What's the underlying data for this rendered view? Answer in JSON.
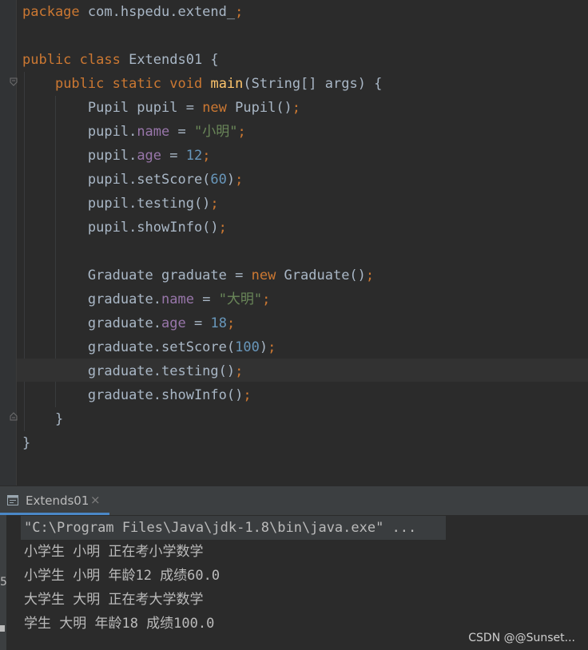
{
  "editor": {
    "lines": [
      {
        "indent": "",
        "tokens": [
          {
            "t": "package ",
            "c": "kw"
          },
          {
            "t": "com.hspedu.extend_",
            "c": "pl"
          },
          {
            "t": ";",
            "c": "kw"
          }
        ]
      },
      {
        "indent": "",
        "tokens": []
      },
      {
        "indent": "",
        "tokens": [
          {
            "t": "public ",
            "c": "kw"
          },
          {
            "t": "class ",
            "c": "kw"
          },
          {
            "t": "Extends01 {",
            "c": "pl"
          }
        ]
      },
      {
        "indent": "    ",
        "tokens": [
          {
            "t": "public ",
            "c": "kw"
          },
          {
            "t": "static ",
            "c": "kw"
          },
          {
            "t": "void ",
            "c": "kw"
          },
          {
            "t": "main",
            "c": "fn"
          },
          {
            "t": "(String[] args) {",
            "c": "pl"
          }
        ]
      },
      {
        "indent": "        ",
        "tokens": [
          {
            "t": "Pupil pupil = ",
            "c": "pl"
          },
          {
            "t": "new ",
            "c": "kw"
          },
          {
            "t": "Pupil()",
            "c": "pl"
          },
          {
            "t": ";",
            "c": "kw"
          }
        ]
      },
      {
        "indent": "        ",
        "tokens": [
          {
            "t": "pupil.",
            "c": "pl"
          },
          {
            "t": "name",
            "c": "fld"
          },
          {
            "t": " = ",
            "c": "pl"
          },
          {
            "t": "\"小明\"",
            "c": "str"
          },
          {
            "t": ";",
            "c": "kw"
          }
        ]
      },
      {
        "indent": "        ",
        "tokens": [
          {
            "t": "pupil.",
            "c": "pl"
          },
          {
            "t": "age",
            "c": "fld"
          },
          {
            "t": " = ",
            "c": "pl"
          },
          {
            "t": "12",
            "c": "num"
          },
          {
            "t": ";",
            "c": "kw"
          }
        ]
      },
      {
        "indent": "        ",
        "tokens": [
          {
            "t": "pupil.setScore(",
            "c": "pl"
          },
          {
            "t": "60",
            "c": "num"
          },
          {
            "t": ")",
            "c": "pl"
          },
          {
            "t": ";",
            "c": "kw"
          }
        ]
      },
      {
        "indent": "        ",
        "tokens": [
          {
            "t": "pupil.testing()",
            "c": "pl"
          },
          {
            "t": ";",
            "c": "kw"
          }
        ]
      },
      {
        "indent": "        ",
        "tokens": [
          {
            "t": "pupil.showInfo()",
            "c": "pl"
          },
          {
            "t": ";",
            "c": "kw"
          }
        ]
      },
      {
        "indent": "",
        "tokens": []
      },
      {
        "indent": "        ",
        "tokens": [
          {
            "t": "Graduate graduate = ",
            "c": "pl"
          },
          {
            "t": "new ",
            "c": "kw"
          },
          {
            "t": "Graduate()",
            "c": "pl"
          },
          {
            "t": ";",
            "c": "kw"
          }
        ]
      },
      {
        "indent": "        ",
        "tokens": [
          {
            "t": "graduate.",
            "c": "pl"
          },
          {
            "t": "name",
            "c": "fld"
          },
          {
            "t": " = ",
            "c": "pl"
          },
          {
            "t": "\"大明\"",
            "c": "str"
          },
          {
            "t": ";",
            "c": "kw"
          }
        ]
      },
      {
        "indent": "        ",
        "tokens": [
          {
            "t": "graduate.",
            "c": "pl"
          },
          {
            "t": "age",
            "c": "fld"
          },
          {
            "t": " = ",
            "c": "pl"
          },
          {
            "t": "18",
            "c": "num"
          },
          {
            "t": ";",
            "c": "kw"
          }
        ]
      },
      {
        "indent": "        ",
        "tokens": [
          {
            "t": "graduate.setScore(",
            "c": "pl"
          },
          {
            "t": "100",
            "c": "num"
          },
          {
            "t": ")",
            "c": "pl"
          },
          {
            "t": ";",
            "c": "kw"
          }
        ]
      },
      {
        "indent": "        ",
        "tokens": [
          {
            "t": "graduate.testing()",
            "c": "pl"
          },
          {
            "t": ";",
            "c": "kw"
          }
        ]
      },
      {
        "indent": "        ",
        "tokens": [
          {
            "t": "graduate.showInfo()",
            "c": "pl"
          },
          {
            "t": ";",
            "c": "kw"
          }
        ]
      },
      {
        "indent": "    ",
        "tokens": [
          {
            "t": "}",
            "c": "pl"
          }
        ]
      },
      {
        "indent": "",
        "tokens": [
          {
            "t": "}",
            "c": "pl"
          }
        ]
      }
    ]
  },
  "run_panel": {
    "tab_label": "Extends01",
    "tab_close": "×",
    "strip_glyphs": [
      "5"
    ],
    "console": [
      "\"C:\\Program Files\\Java\\jdk-1.8\\bin\\java.exe\" ...",
      "小学生 小明 正在考小学数学",
      "小学生 小明 年龄12 成绩60.0",
      "大学生 大明 正在考大学数学",
      "学生 大明 年龄18 成绩100.0"
    ]
  },
  "watermark": "CSDN @@Sunset...",
  "colors": {
    "keyword": "#cc7832",
    "field": "#9876aa",
    "string": "#6a8759",
    "number": "#6897bb",
    "method_decl": "#ffc66d",
    "plain": "#a9b7c6",
    "tab_underline": "#4a88c7"
  },
  "icons": {
    "fold_marker": "fold-marker-icon",
    "run_tab": "run-console-icon"
  }
}
